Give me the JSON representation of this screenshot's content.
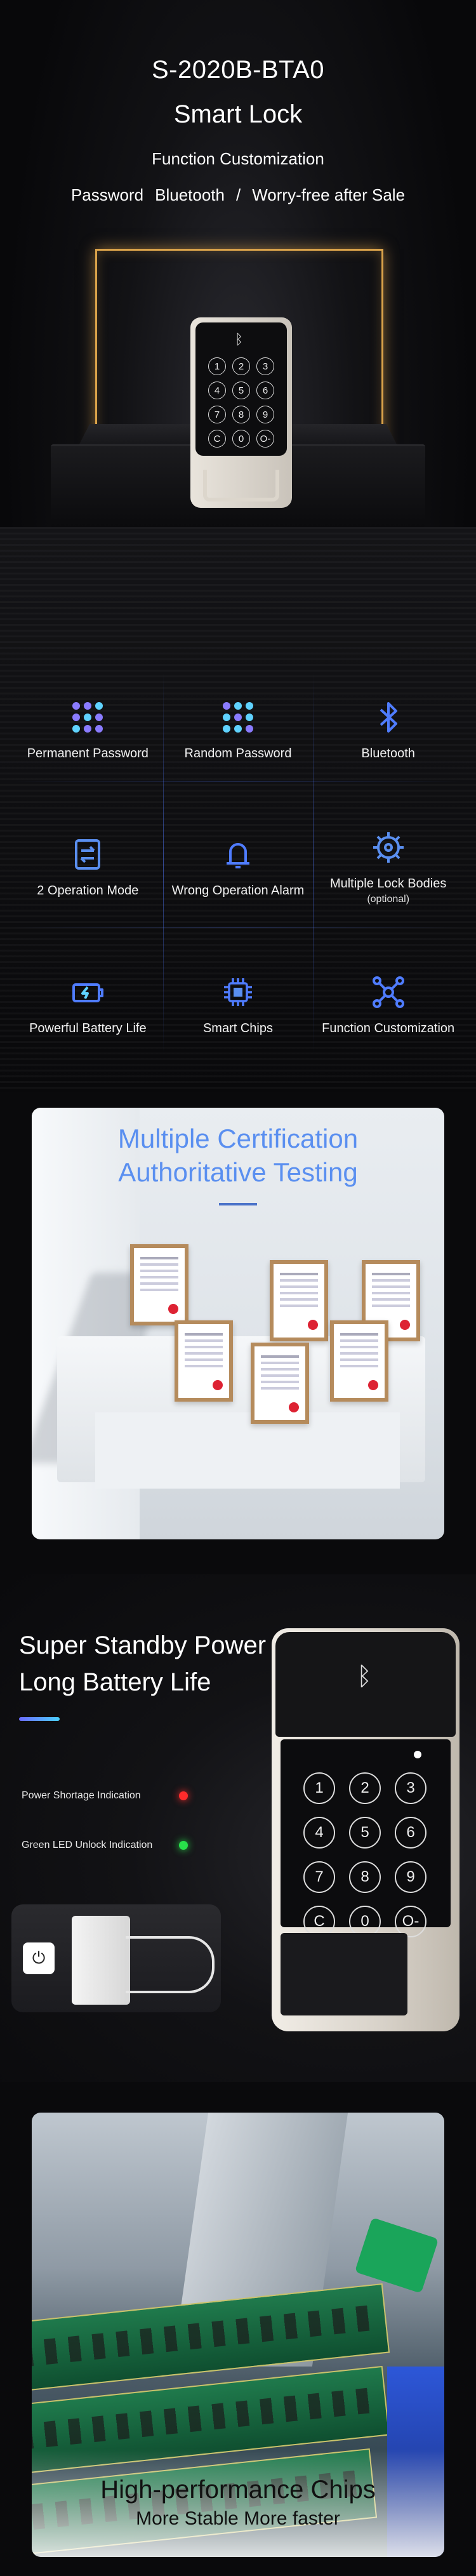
{
  "hero": {
    "model": "S-2020B-BTA0",
    "product": "Smart Lock",
    "subtitle": "Function Customization",
    "tagline": [
      "Password",
      "Bluetooth",
      "/",
      "Worry-free after Sale"
    ],
    "keypad": [
      "1",
      "2",
      "3",
      "4",
      "5",
      "6",
      "7",
      "8",
      "9",
      "C",
      "0",
      "O-"
    ]
  },
  "features": [
    {
      "icon": "dots-grid-icon",
      "label": "Permanent Password",
      "sub": ""
    },
    {
      "icon": "dots-grid-icon",
      "label": "Random Password",
      "sub": ""
    },
    {
      "icon": "bluetooth-icon",
      "label": "Bluetooth",
      "sub": ""
    },
    {
      "icon": "mode-switch-icon",
      "label": "2 Operation Mode",
      "sub": ""
    },
    {
      "icon": "bell-icon",
      "label": "Wrong Operation Alarm",
      "sub": ""
    },
    {
      "icon": "gear-icon",
      "label": "Multiple Lock Bodies",
      "sub": "(optional)"
    },
    {
      "icon": "battery-icon",
      "label": "Powerful Battery Life",
      "sub": ""
    },
    {
      "icon": "chip-icon",
      "label": "Smart Chips",
      "sub": ""
    },
    {
      "icon": "network-icon",
      "label": "Function Customization",
      "sub": ""
    }
  ],
  "certification": {
    "line1": "Multiple Certification",
    "line2": "Authoritative Testing"
  },
  "battery": {
    "line1": "Super Standby Power",
    "line2": "Long Battery Life",
    "indicator_red": "Power Shortage Indication",
    "indicator_green": "Green LED Unlock Indication",
    "keypad": [
      "1",
      "2",
      "3",
      "4",
      "5",
      "6",
      "7",
      "8",
      "9",
      "C",
      "0",
      "O-"
    ]
  },
  "chips": {
    "line1": "High-performance Chips",
    "line2": "More Stable More faster"
  },
  "colors": {
    "accent_blue": "#5a8ff0",
    "frame_gold": "#d9a24a",
    "red_led": "#ff2b2b",
    "green_led": "#28e04a"
  }
}
